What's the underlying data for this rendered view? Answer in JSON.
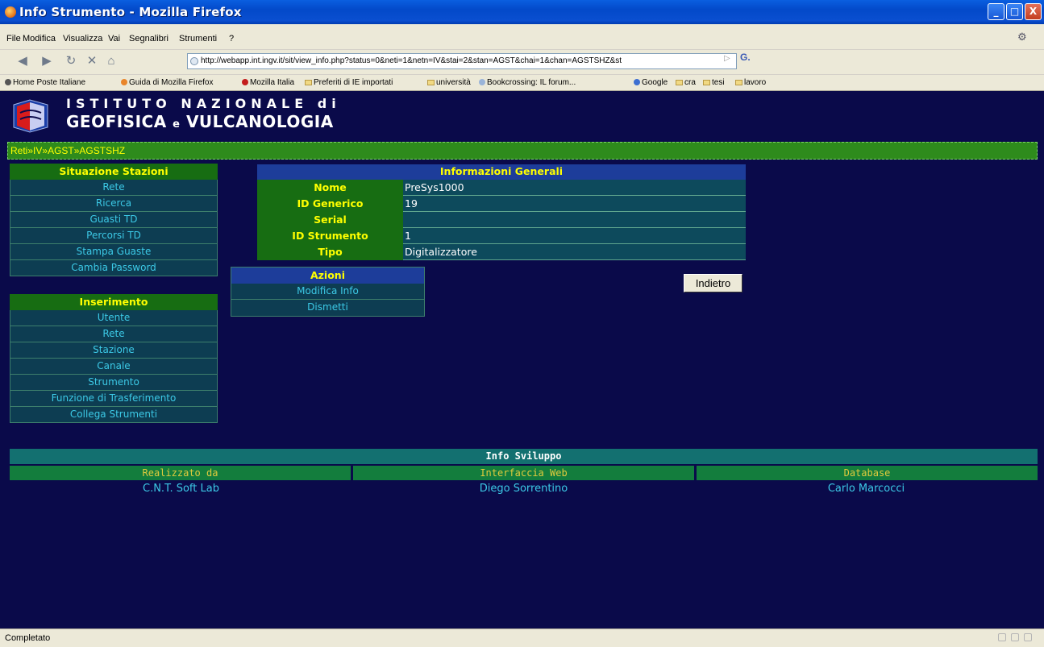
{
  "window": {
    "title": "Info Strumento - Mozilla Firefox",
    "buttons": [
      "_",
      "□",
      "X"
    ]
  },
  "menu": [
    "File",
    "Modifica",
    "Visualizza",
    "Vai",
    "Segnalibri",
    "Strumenti",
    "?"
  ],
  "nav": {
    "url": "http://webapp.int.ingv.it/sit/view_info.php?status=0&neti=1&netn=IV&stai=2&stan=AGST&chai=1&chan=AGSTSHZ&st",
    "go_label": "▷",
    "search_label": "G."
  },
  "bookmarks": [
    "Home Poste Italiane",
    "Guida di Mozilla Firefox",
    "Mozilla Italia",
    "Preferiti di IE importati",
    "università",
    "Bookcrossing: IL forum...",
    "Google",
    "cra",
    "tesi",
    "lavoro"
  ],
  "logo": {
    "line1": "ISTITUTO NAZIONALE di",
    "line2a": "GEOFISICA",
    "line2b": "e",
    "line2c": "VULCANOLOGIA"
  },
  "breadcrumb": [
    "Reti",
    "IV",
    "AGST",
    "AGSTSHZ"
  ],
  "sidebar": {
    "situazione": {
      "title": "Situazione Stazioni",
      "items": [
        "Rete",
        "Ricerca",
        "Guasti TD",
        "Percorsi TD",
        "Stampa Guaste",
        "Cambia Password"
      ]
    },
    "inserimento": {
      "title": "Inserimento",
      "items": [
        "Utente",
        "Rete",
        "Stazione",
        "Canale",
        "Strumento",
        "Funzione di Trasferimento",
        "Collega Strumenti"
      ]
    }
  },
  "info": {
    "title": "Informazioni Generali",
    "rows": [
      {
        "label": "Nome",
        "value": "PreSys1000"
      },
      {
        "label": "ID Generico",
        "value": "19"
      },
      {
        "label": "Serial",
        "value": ""
      },
      {
        "label": "ID Strumento",
        "value": "1"
      },
      {
        "label": "Tipo",
        "value": "Digitalizzatore"
      }
    ]
  },
  "azioni": {
    "title": "Azioni",
    "items": [
      "Modifica Info",
      "Dismetti"
    ]
  },
  "back_button": "Indietro",
  "dev_info": {
    "title": "Info Sviluppo",
    "columns": [
      "Realizzato da",
      "Interfaccia Web",
      "Database"
    ],
    "values": [
      "C.N.T. Soft Lab",
      "Diego Sorrentino",
      "Carlo Marcocci"
    ]
  },
  "status": {
    "text": "Completato"
  },
  "colors": {
    "page_bg": "#0a0a4a",
    "header_green": "#176d12",
    "header_blue": "#1d3d9a",
    "accent_yellow": "#ffff00",
    "link_cyan": "#3cc9e6"
  }
}
